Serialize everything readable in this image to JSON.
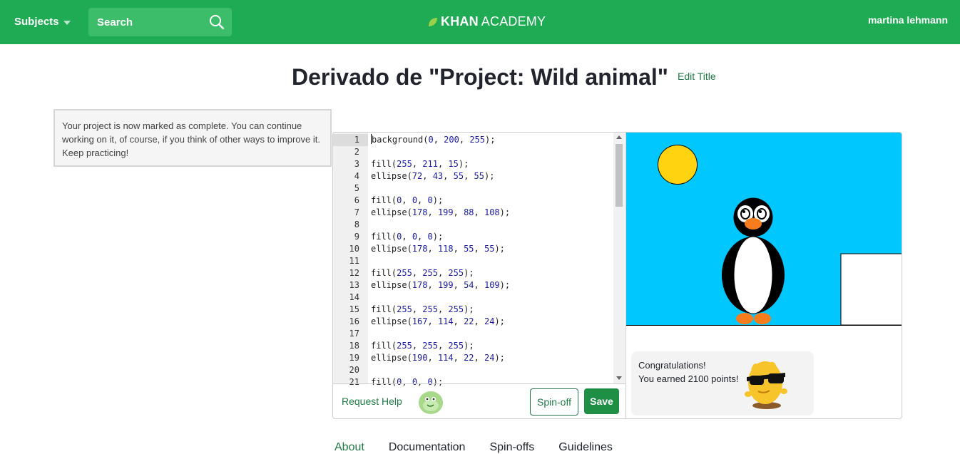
{
  "header": {
    "subjects_label": "Subjects",
    "search_label": "Search",
    "logo_left": "KHAN",
    "logo_right": "ACADEMY",
    "username": "martina lehmann"
  },
  "page": {
    "title": "Derivado de \"Project: Wild animal\"",
    "edit_title": "Edit Title",
    "notice": "Your project is now marked as complete. You can continue working on it, of course, if you think of other ways to improve it. Keep practicing!"
  },
  "editor": {
    "lines": [
      {
        "n": "1",
        "text": "background(0, 200, 255);"
      },
      {
        "n": "2",
        "text": ""
      },
      {
        "n": "3",
        "text": "fill(255, 211, 15);"
      },
      {
        "n": "4",
        "text": "ellipse(72, 43, 55, 55);"
      },
      {
        "n": "5",
        "text": ""
      },
      {
        "n": "6",
        "text": "fill(0, 0, 0);"
      },
      {
        "n": "7",
        "text": "ellipse(178, 199, 88, 108);"
      },
      {
        "n": "8",
        "text": ""
      },
      {
        "n": "9",
        "text": "fill(0, 0, 0);"
      },
      {
        "n": "10",
        "text": "ellipse(178, 118, 55, 55);"
      },
      {
        "n": "11",
        "text": ""
      },
      {
        "n": "12",
        "text": "fill(255, 255, 255);"
      },
      {
        "n": "13",
        "text": "ellipse(178, 199, 54, 109);"
      },
      {
        "n": "14",
        "text": ""
      },
      {
        "n": "15",
        "text": "fill(255, 255, 255);"
      },
      {
        "n": "16",
        "text": "ellipse(167, 114, 22, 24);"
      },
      {
        "n": "17",
        "text": ""
      },
      {
        "n": "18",
        "text": "fill(255, 255, 255);"
      },
      {
        "n": "19",
        "text": "ellipse(190, 114, 22, 24);"
      },
      {
        "n": "20",
        "text": ""
      },
      {
        "n": "21",
        "text": "fill(0, 0, 0);"
      }
    ],
    "request_help": "Request Help",
    "spinoff_label": "Spin-off",
    "save_label": "Save"
  },
  "canvas": {
    "sky_color": "#00c8ff",
    "sun_color": "#ffd30f",
    "beak_color": "#f97c1c"
  },
  "congrats": {
    "title": "Congratulations!",
    "text": "You earned 2100 points!"
  },
  "tabs": [
    {
      "label": "About",
      "active": true
    },
    {
      "label": "Documentation",
      "active": false
    },
    {
      "label": "Spin-offs",
      "active": false
    },
    {
      "label": "Guidelines",
      "active": false
    }
  ]
}
